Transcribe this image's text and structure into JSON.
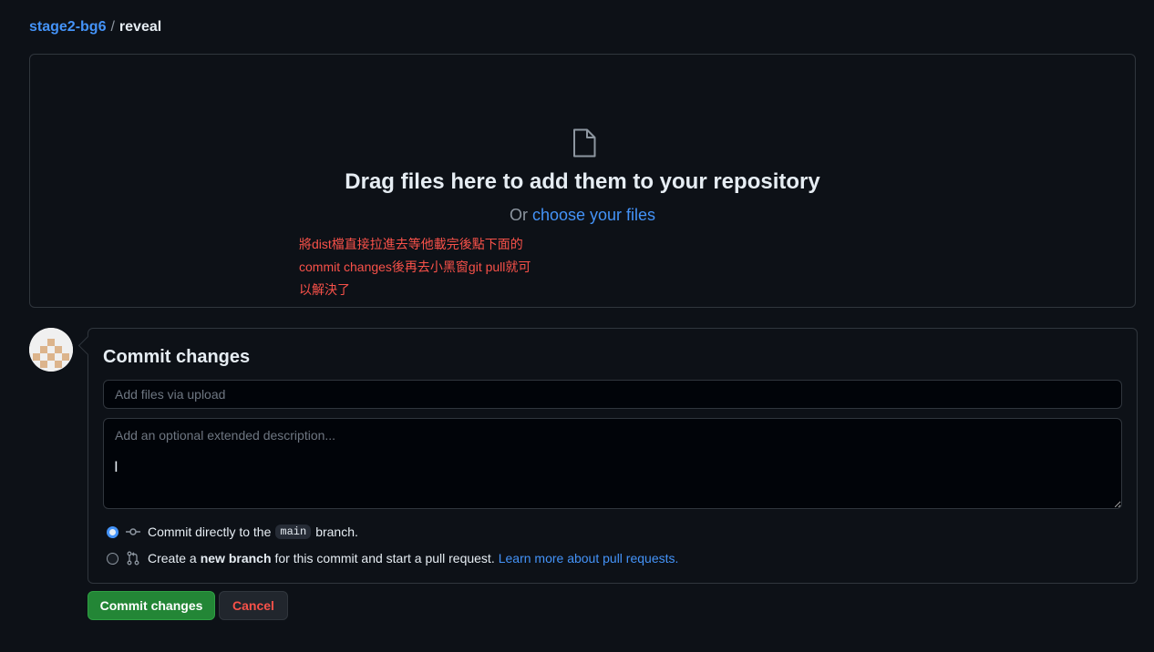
{
  "breadcrumb": {
    "owner": "stage2-bg6",
    "separator": "/",
    "repo": "reveal"
  },
  "dropzone": {
    "title": "Drag files here to add them to your repository",
    "or_text": "Or",
    "choose_link": "choose your files",
    "annotation_lines": [
      "將dist檔直接拉進去等他載完後點下面的",
      "commit changes後再去小黑窗git pull就可",
      "以解決了"
    ]
  },
  "commit": {
    "title": "Commit changes",
    "summary_placeholder": "Add files via upload",
    "description_placeholder": "Add an optional extended description...",
    "option_direct": {
      "prefix": "Commit directly to the",
      "branch": "main",
      "suffix": "branch.",
      "selected": true
    },
    "option_new": {
      "prefix": "Create a",
      "strong": "new branch",
      "suffix": "for this commit and start a pull request.",
      "link": "Learn more about pull requests.",
      "selected": false
    }
  },
  "buttons": {
    "commit": "Commit changes",
    "cancel": "Cancel"
  },
  "colors": {
    "accent": "#4493f8",
    "danger": "#f85149",
    "primary_button": "#238636",
    "background": "#0d1117"
  }
}
